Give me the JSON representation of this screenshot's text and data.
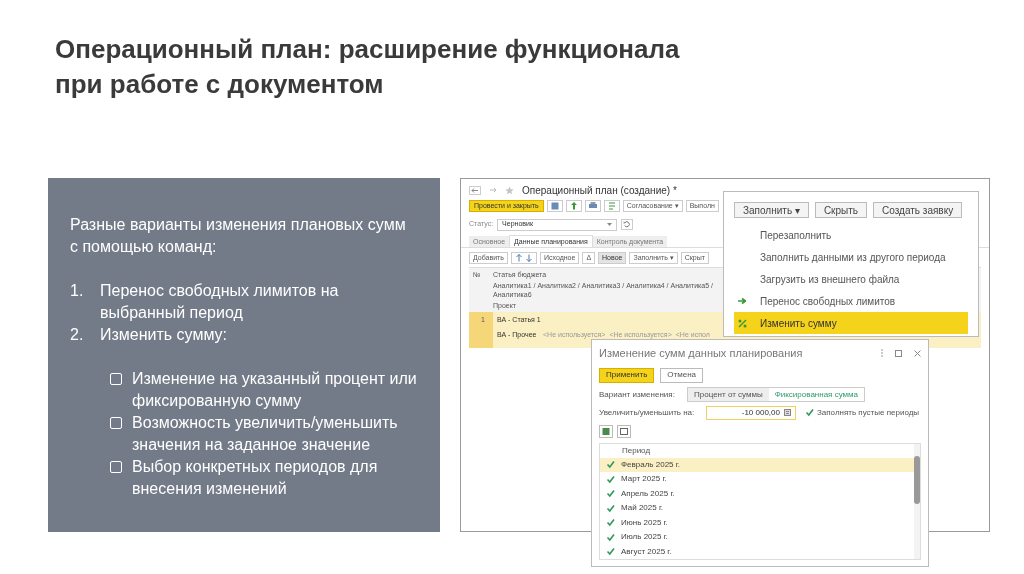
{
  "title": "Операционный план: расширение функционала при работе с документом",
  "panel": {
    "intro": "Разные варианты изменения плановых сумм с помощью команд:",
    "steps": [
      {
        "number": "1.",
        "text": "Перенос свободных лимитов на выбранный период"
      },
      {
        "number": "2.",
        "text": "Изменить сумму:"
      }
    ],
    "bullets": [
      "Изменение на указанный процент или фиксированную сумму",
      "Возможность увеличить/уменьшить значения на заданное значение",
      "Выбор конкретных периодов для внесения изменений"
    ]
  },
  "app": {
    "window_title": "Операционный план (создание) *",
    "toolbar": [
      {
        "kind": "primary",
        "label": "Провести и закрыть"
      },
      {
        "kind": "icon"
      },
      {
        "kind": "icon"
      },
      {
        "kind": "icon"
      },
      {
        "kind": "icon"
      },
      {
        "kind": "text",
        "label": "Согласование ▾"
      },
      {
        "kind": "text",
        "label": "Выполн"
      }
    ],
    "status_label": "Статус:",
    "status_value": "Черновик",
    "tabs": [
      {
        "label": "Основное",
        "selected": false
      },
      {
        "label": "Данные планирования",
        "selected": true
      },
      {
        "label": "Контроль документа",
        "selected": false
      }
    ],
    "table_toolbar": [
      {
        "kind": "text",
        "label": "Добавить",
        "selected": false
      },
      {
        "kind": "arrows",
        "selected": false
      },
      {
        "kind": "text",
        "label": "Исходное",
        "selected": false
      },
      {
        "kind": "text",
        "label": "Δ",
        "selected": false
      },
      {
        "kind": "text",
        "label": "Новое",
        "selected": true
      },
      {
        "kind": "text",
        "label": "Заполнить ▾",
        "selected": false
      },
      {
        "kind": "text",
        "label": "Скрыт",
        "selected": false
      }
    ],
    "columns": {
      "number": "№",
      "article": "Статья бюджета",
      "analytics": "Аналитика1 / Аналитика2 / Аналитика3 / Аналитика4 / Аналитика5 / Аналитика6",
      "project": "Проект"
    },
    "rows": [
      {
        "number": "1",
        "article": "ВА - Статья 1",
        "analytics": "ВА - Прочее",
        "unused": [
          "<Не используется>",
          "<Не используется>",
          "<Не испол"
        ],
        "selected": true
      }
    ]
  },
  "fill_menu": {
    "buttons": [
      "Заполнить ▾",
      "Скрыть",
      "Создать заявку"
    ],
    "items": [
      {
        "label": "Перезаполнить",
        "kind": "plain",
        "selected": false
      },
      {
        "label": "Заполнить данными из другого периода",
        "kind": "plain",
        "selected": false
      },
      {
        "label": "Загрузить из внешнего файла",
        "kind": "plain",
        "selected": false
      },
      {
        "label": "Перенос свободных лимитов",
        "kind": "transfer",
        "selected": false
      },
      {
        "label": "Изменить сумму",
        "kind": "percent",
        "selected": true
      }
    ]
  },
  "dialog": {
    "title": "Изменение сумм данных планирования",
    "apply": "Применить",
    "cancel": "Отмена",
    "variant_label": "Вариант изменения:",
    "variants": [
      {
        "label": "Процент от суммы",
        "selected": false
      },
      {
        "label": "Фиксированная сумма",
        "selected": true
      }
    ],
    "amount_label": "Увеличить/уменьшить на:",
    "amount": "-10 000,00",
    "fill_empty": {
      "label": "Заполнять пустые периоды",
      "checked": true
    },
    "period_header": "Период",
    "periods": [
      {
        "label": "Февраль 2025 г.",
        "checked": true,
        "selected": true
      },
      {
        "label": "Март 2025 г.",
        "checked": true,
        "selected": false
      },
      {
        "label": "Апрель 2025 г.",
        "checked": true,
        "selected": false
      },
      {
        "label": "Май 2025 г.",
        "checked": true,
        "selected": false
      },
      {
        "label": "Июнь 2025 г.",
        "checked": true,
        "selected": false
      },
      {
        "label": "Июль 2025 г.",
        "checked": true,
        "selected": false
      },
      {
        "label": "Август 2025 г.",
        "checked": true,
        "selected": false
      }
    ]
  }
}
